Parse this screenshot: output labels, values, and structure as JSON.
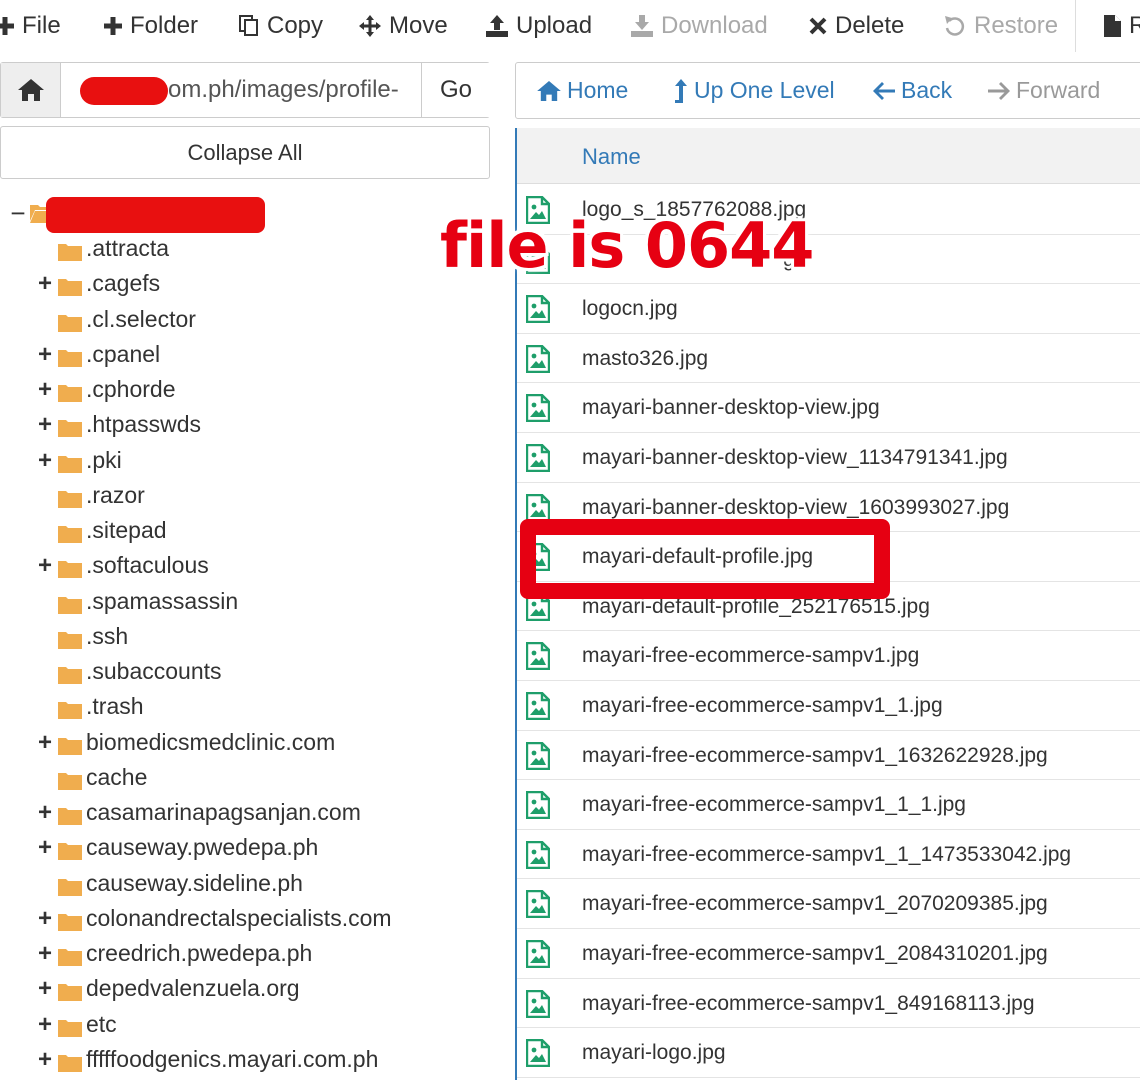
{
  "toolbar": {
    "file": "File",
    "folder": "Folder",
    "copy": "Copy",
    "move": "Move",
    "upload": "Upload",
    "download": "Download",
    "delete": "Delete",
    "restore": "Restore",
    "partial": "R"
  },
  "address": {
    "value": "om.ph/images/profile-",
    "go": "Go"
  },
  "collapse_all": "Collapse All",
  "tree": {
    "items": [
      {
        "label": ".attracta",
        "expandable": false
      },
      {
        "label": ".cagefs",
        "expandable": true
      },
      {
        "label": ".cl.selector",
        "expandable": false
      },
      {
        "label": ".cpanel",
        "expandable": true
      },
      {
        "label": ".cphorde",
        "expandable": true
      },
      {
        "label": ".htpasswds",
        "expandable": true
      },
      {
        "label": ".pki",
        "expandable": true
      },
      {
        "label": ".razor",
        "expandable": false
      },
      {
        "label": ".sitepad",
        "expandable": false
      },
      {
        "label": ".softaculous",
        "expandable": true
      },
      {
        "label": ".spamassassin",
        "expandable": false
      },
      {
        "label": ".ssh",
        "expandable": false
      },
      {
        "label": ".subaccounts",
        "expandable": false
      },
      {
        "label": ".trash",
        "expandable": false
      },
      {
        "label": "biomedicsmedclinic.com",
        "expandable": true
      },
      {
        "label": "cache",
        "expandable": false
      },
      {
        "label": "casamarinapagsanjan.com",
        "expandable": true
      },
      {
        "label": "causeway.pwedepa.ph",
        "expandable": true
      },
      {
        "label": "causeway.sideline.ph",
        "expandable": false
      },
      {
        "label": "colonandrectalspecialists.com",
        "expandable": true
      },
      {
        "label": "creedrich.pwedepa.ph",
        "expandable": true
      },
      {
        "label": "depedvalenzuela.org",
        "expandable": true
      },
      {
        "label": "etc",
        "expandable": true
      },
      {
        "label": "fffffoodgenics.mayari.com.ph",
        "expandable": true
      }
    ]
  },
  "nav": {
    "home": "Home",
    "up": "Up One Level",
    "back": "Back",
    "forward": "Forward"
  },
  "filelist": {
    "header": "Name",
    "files": [
      "logo_s_1857762088.jpg",
      " ",
      "logocn.jpg",
      "masto326.jpg",
      "mayari-banner-desktop-view.jpg",
      "mayari-banner-desktop-view_1134791341.jpg",
      "mayari-banner-desktop-view_1603993027.jpg",
      "mayari-default-profile.jpg",
      "mayari-default-profile_252176515.jpg",
      "mayari-free-ecommerce-sampv1.jpg",
      "mayari-free-ecommerce-sampv1_1.jpg",
      "mayari-free-ecommerce-sampv1_1632622928.jpg",
      "mayari-free-ecommerce-sampv1_1_1.jpg",
      "mayari-free-ecommerce-sampv1_1_1473533042.jpg",
      "mayari-free-ecommerce-sampv1_2070209385.jpg",
      "mayari-free-ecommerce-sampv1_2084310201.jpg",
      "mayari-free-ecommerce-sampv1_849168113.jpg",
      "mayari-logo.jpg"
    ],
    "partial_second": "g"
  },
  "annotation": {
    "text": "file is 0644"
  },
  "colors": {
    "accent": "#337ab7",
    "folder": "#f0ad4e",
    "file_icon": "#1e9e6a",
    "annotation": "#e60012"
  }
}
